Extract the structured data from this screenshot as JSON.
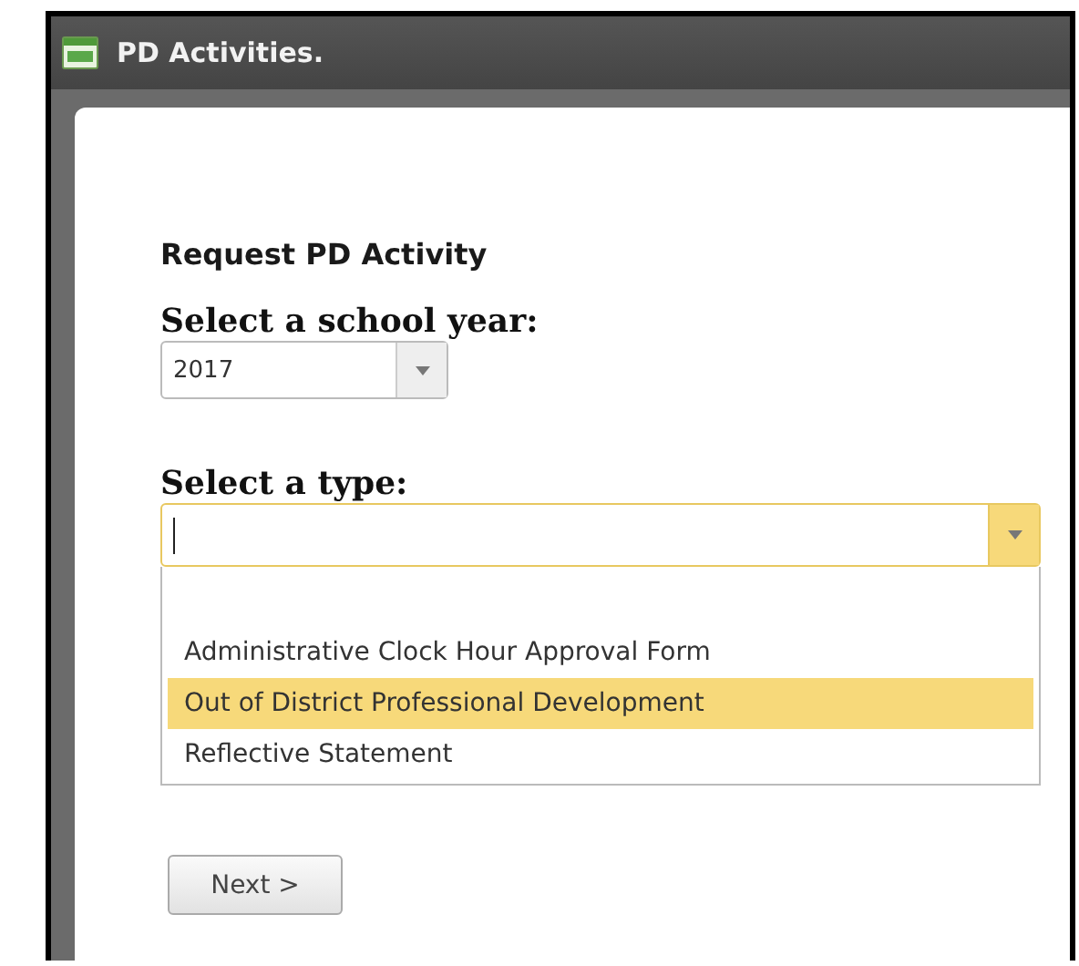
{
  "window": {
    "title": "PD Activities."
  },
  "form": {
    "heading": "Request PD Activity",
    "school_year": {
      "label": "Select a school year:",
      "value": "2017"
    },
    "type": {
      "label": "Select a type:",
      "expanded": true,
      "options": [
        {
          "label": "Administrative Clock Hour Approval Form",
          "selected": false
        },
        {
          "label": "Out of District Professional Development",
          "selected": true
        },
        {
          "label": "Reflective Statement",
          "selected": false
        }
      ]
    },
    "buttons": [
      "Next >"
    ]
  }
}
